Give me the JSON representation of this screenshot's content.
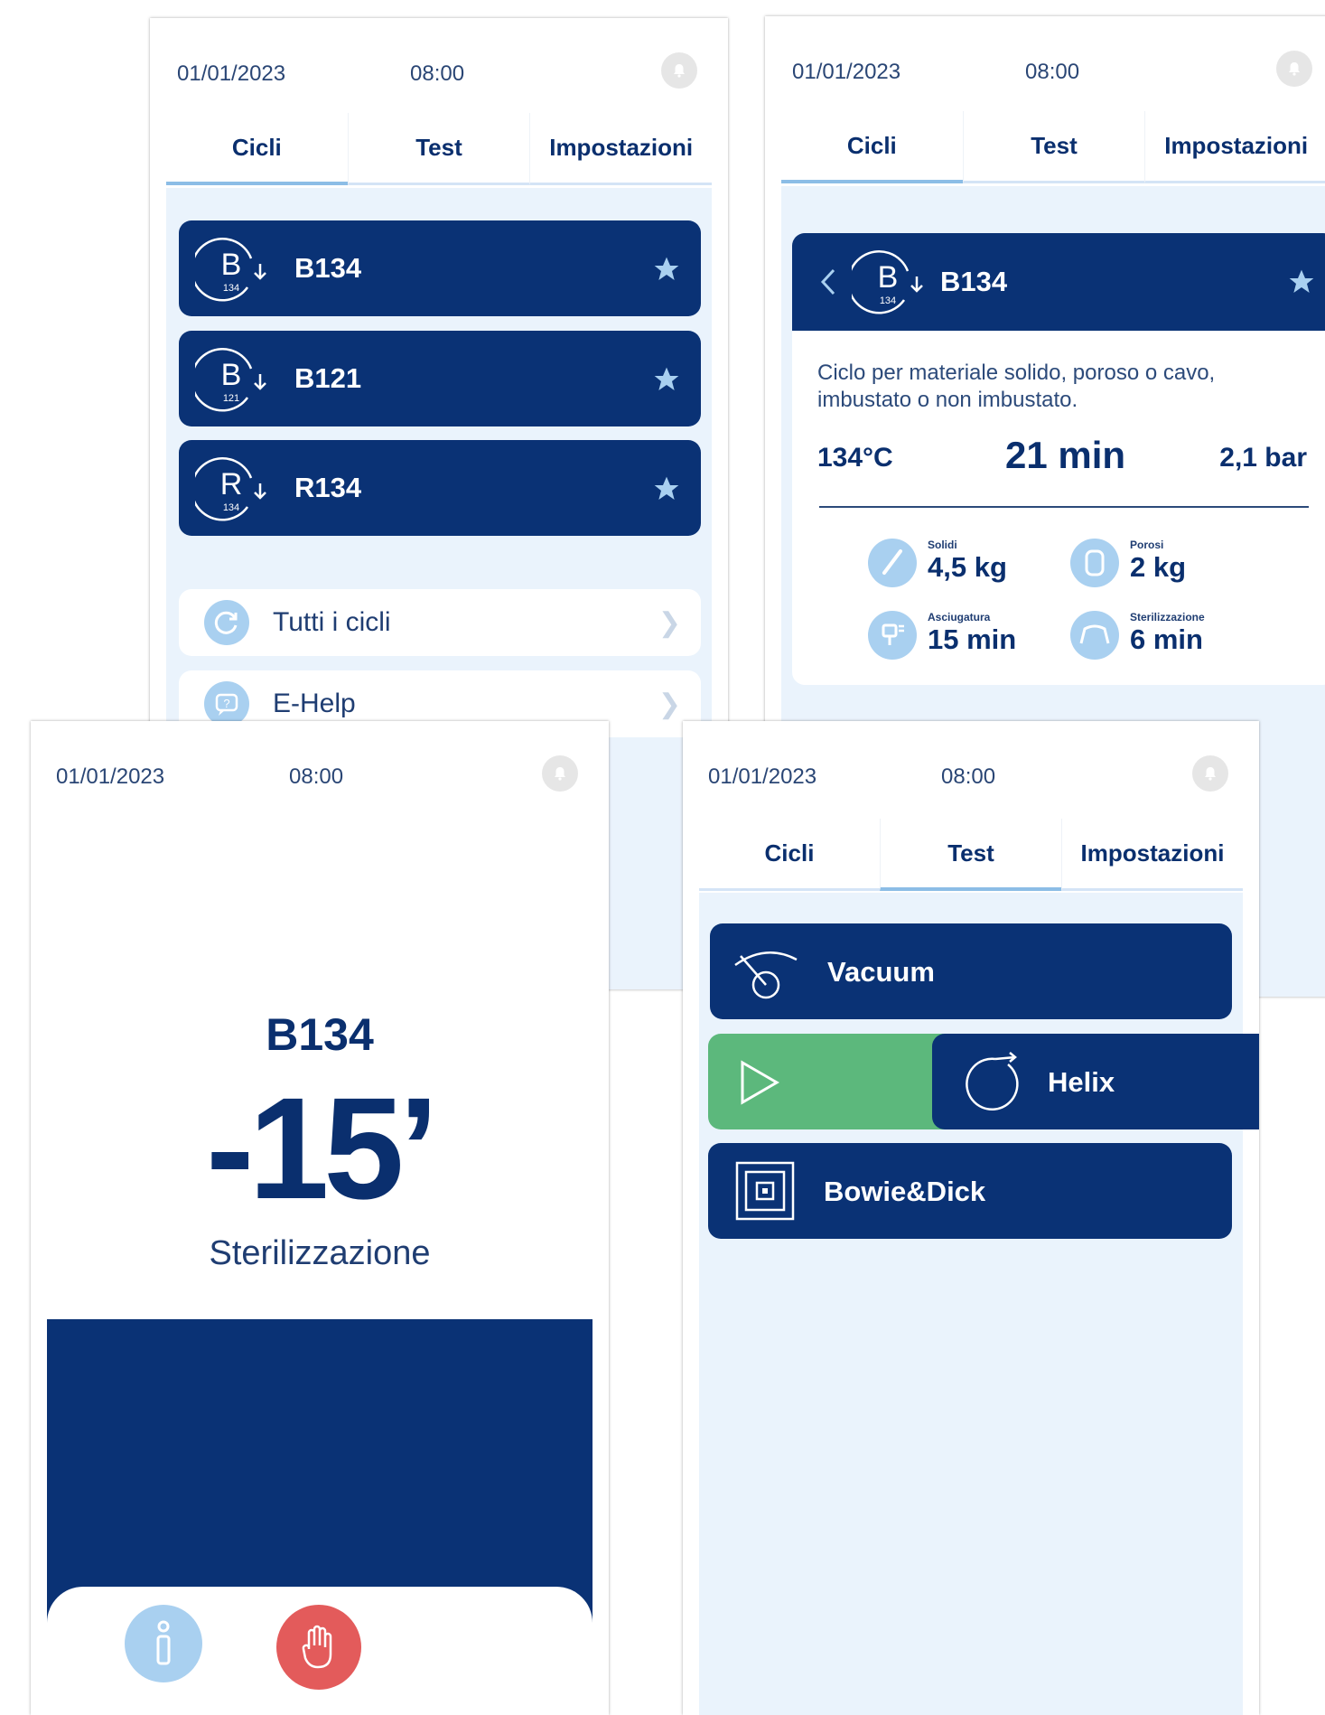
{
  "status": {
    "date": "01/01/2023",
    "time": "08:00"
  },
  "tabs": {
    "cycles": "Cicli",
    "test": "Test",
    "settings": "Impostazioni"
  },
  "cycles": [
    {
      "name": "B134",
      "icon_letter": "B",
      "icon_num": "134"
    },
    {
      "name": "B121",
      "icon_letter": "B",
      "icon_num": "121"
    },
    {
      "name": "R134",
      "icon_letter": "R",
      "icon_num": "134"
    }
  ],
  "links": {
    "all_cycles": "Tutti i cicli",
    "ehelp": "E-Help"
  },
  "detail": {
    "name": "B134",
    "icon_letter": "B",
    "icon_num": "134",
    "description": "Ciclo per materiale solido, poroso o cavo, imbustato o non imbustato.",
    "temperature": "134°C",
    "duration": "21 min",
    "pressure": "2,1 bar",
    "specs": [
      {
        "label": "Solidi",
        "value": "4,5 kg",
        "icon": "instrument-icon"
      },
      {
        "label": "Porosi",
        "value": "2 kg",
        "icon": "porous-icon"
      },
      {
        "label": "Asciugatura",
        "value": "15 min",
        "icon": "drying-icon"
      },
      {
        "label": "Sterilizzazione",
        "value": "6 min",
        "icon": "sterilization-icon"
      }
    ]
  },
  "running": {
    "cycle": "B134",
    "countdown": "-15’",
    "phase": "Sterilizzazione"
  },
  "tests": [
    {
      "name": "Vacuum",
      "icon": "vacuum-icon"
    },
    {
      "name": "Helix",
      "icon": "helix-icon"
    },
    {
      "name": "Bowie&Dick",
      "icon": "bowie-dick-icon"
    }
  ],
  "colors": {
    "navy": "#0a3275",
    "light_blue": "#a9d0f0",
    "panel": "#eaf3fc",
    "play_green": "#5cb87c",
    "stop_red": "#e35b5b"
  }
}
